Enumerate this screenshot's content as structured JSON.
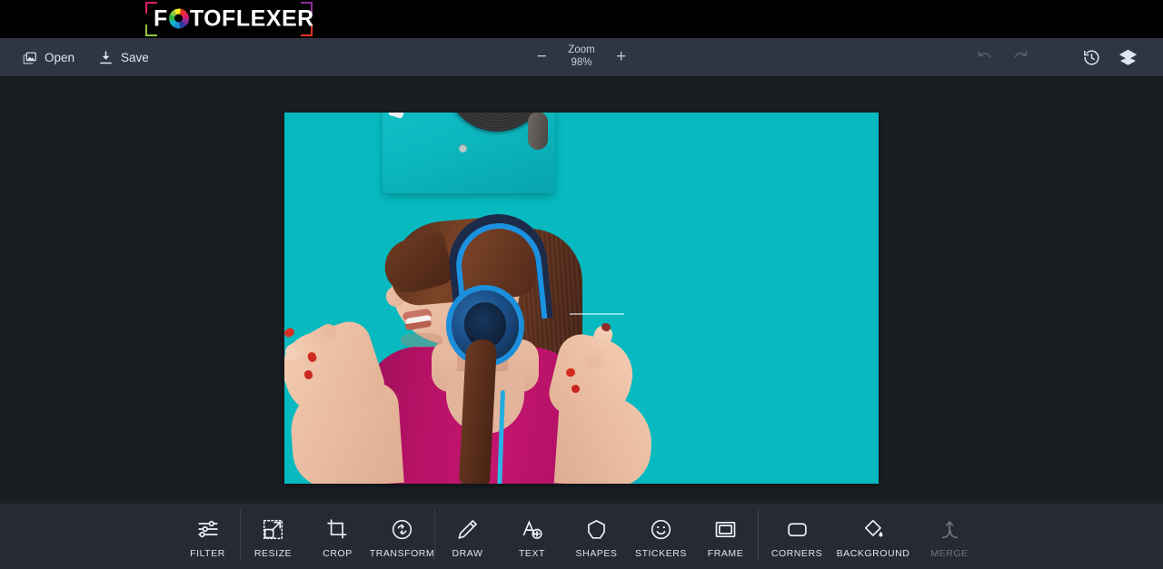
{
  "app": {
    "brand_pre": "F",
    "brand_o_icon": "aperture-icon",
    "brand_post": "TOFLEXER",
    "brand_full": "FOTOFLEXER"
  },
  "colors": {
    "header_bg": "#000000",
    "toolbar_bg": "#2f3542",
    "canvas_bg": "#1a1e23",
    "bottombar_bg": "#262b33",
    "image_teal": "#06bac0",
    "shirt_magenta": "#bc1369",
    "headphone_blue": "#1b8fdc",
    "text_primary": "#dfe6f0",
    "text_disabled": "#6d7480"
  },
  "toolbar": {
    "open_label": "Open",
    "open_icon": "image-stack-icon",
    "save_label": "Save",
    "save_icon": "download-icon",
    "zoom": {
      "minus_label": "−",
      "minus_icon": "minus-icon",
      "title": "Zoom",
      "value": "98%",
      "plus_label": "+",
      "plus_icon": "plus-icon"
    },
    "right_icons": [
      {
        "name": "undo-icon",
        "label": "Undo",
        "disabled": true
      },
      {
        "name": "redo-icon",
        "label": "Redo",
        "disabled": true
      },
      {
        "name": "history-icon",
        "label": "History",
        "disabled": false
      },
      {
        "name": "layers-icon",
        "label": "Layers",
        "disabled": false
      }
    ]
  },
  "canvas": {
    "image_description": "Teal background photo of a smiling woman wearing blue over-ear headphones, pointing up with both index fingers, with a teal turntable and vinyl record above her",
    "image_width": "654",
    "image_height": "409"
  },
  "tools": {
    "groups": [
      {
        "items": [
          {
            "label": "FILTER",
            "icon": "sliders-icon",
            "disabled": false
          }
        ]
      },
      {
        "items": [
          {
            "label": "RESIZE",
            "icon": "resize-icon",
            "disabled": false
          },
          {
            "label": "CROP",
            "icon": "crop-icon",
            "disabled": false
          },
          {
            "label": "TRANSFORM",
            "icon": "transform-icon",
            "disabled": false
          }
        ]
      },
      {
        "items": [
          {
            "label": "DRAW",
            "icon": "pencil-icon",
            "disabled": false
          },
          {
            "label": "TEXT",
            "icon": "text-add-icon",
            "disabled": false
          },
          {
            "label": "SHAPES",
            "icon": "polygon-icon",
            "disabled": false
          },
          {
            "label": "STICKERS",
            "icon": "smiley-icon",
            "disabled": false
          },
          {
            "label": "FRAME",
            "icon": "frame-icon",
            "disabled": false
          }
        ]
      },
      {
        "items": [
          {
            "label": "CORNERS",
            "icon": "rounded-rect-icon",
            "disabled": false
          },
          {
            "label": "BACKGROUND",
            "icon": "paint-bucket-icon",
            "disabled": false
          },
          {
            "label": "MERGE",
            "icon": "merge-arrows-icon",
            "disabled": true
          }
        ]
      }
    ]
  }
}
